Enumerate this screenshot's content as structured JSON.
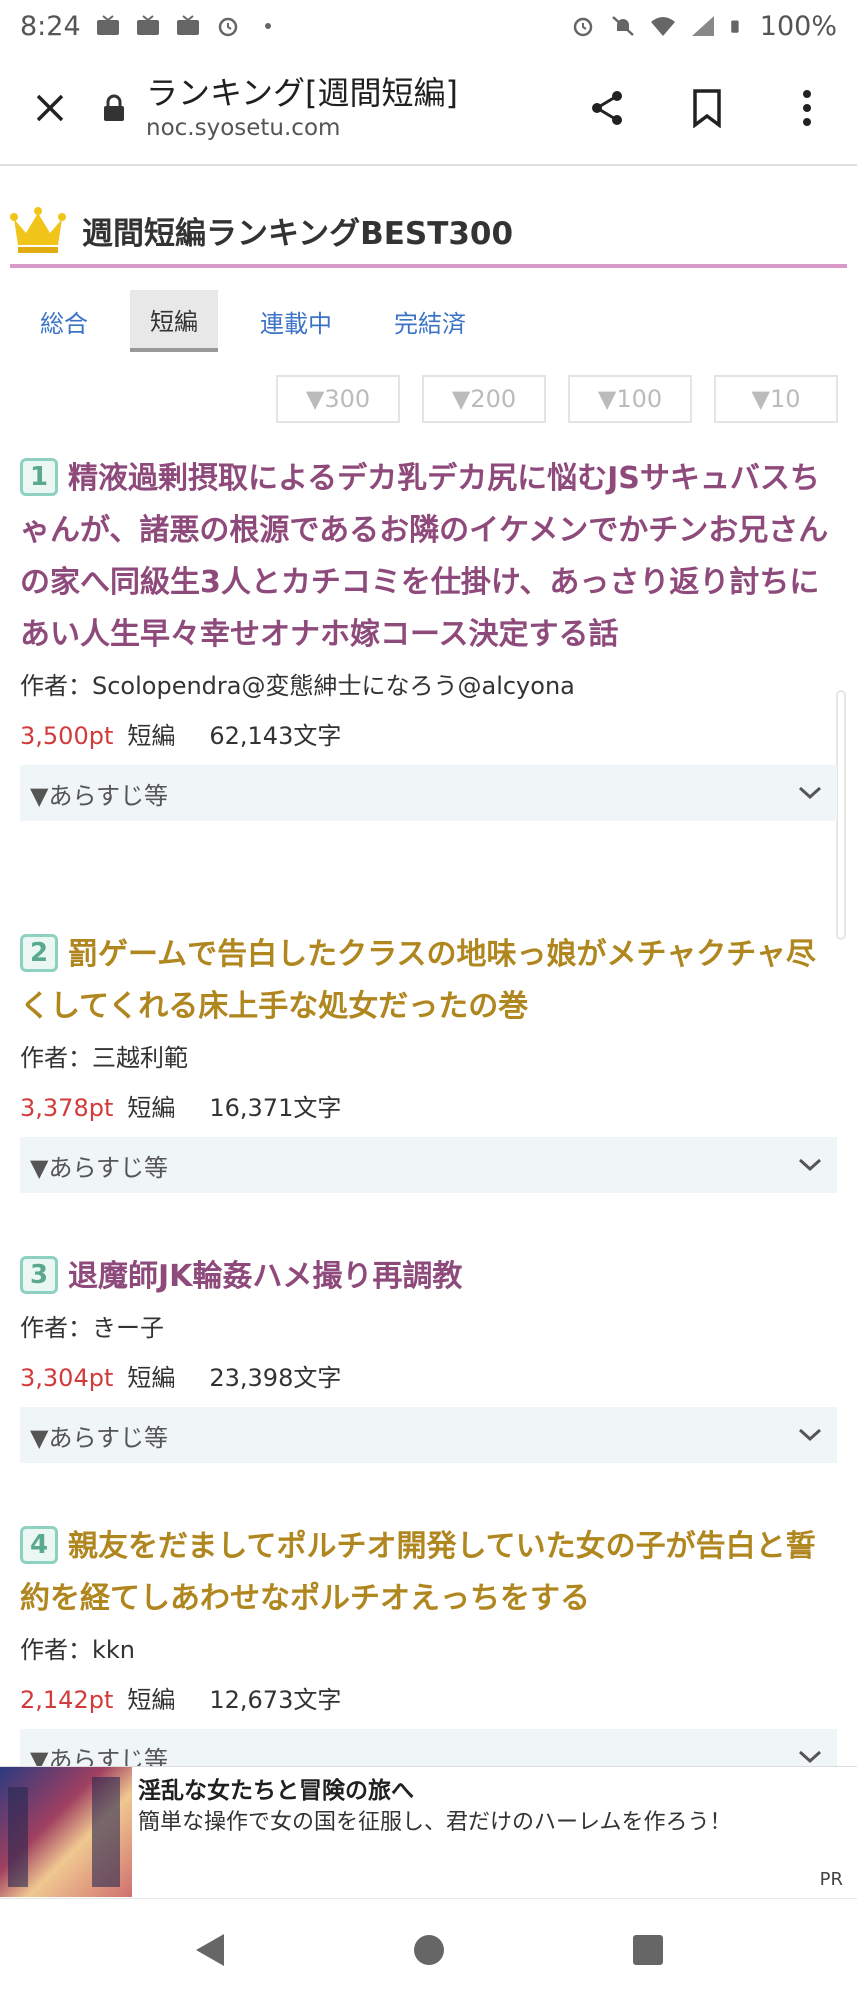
{
  "status_bar": {
    "time": "8:24",
    "battery": "100%"
  },
  "browser": {
    "title": "ランキング[週間短編]",
    "domain": "noc.syosetu.com"
  },
  "header": {
    "title": "週間短編ランキングBEST300"
  },
  "tabs": [
    {
      "label": "総合",
      "active": false
    },
    {
      "label": "短編",
      "active": true
    },
    {
      "label": "連載中",
      "active": false
    },
    {
      "label": "完結済",
      "active": false
    }
  ],
  "filters": [
    "▼300",
    "▼200",
    "▼100",
    "▼10"
  ],
  "entries": [
    {
      "rank": "1",
      "title": "精液過剰摂取によるデカ乳デカ尻に悩むJSサキュバスちゃんが、諸悪の根源であるお隣のイケメンでかチンお兄さんの家へ同級生3人とカチコミを仕掛け、あっさり返り討ちにあい人生早々幸せオナホ嫁コース決定する話",
      "author": "作者：Scolopendra@変態紳士になろう@alcyona",
      "points": "3,500pt",
      "genre": "短編",
      "length": "62,143文字",
      "summary": "▼あらすじ等"
    },
    {
      "rank": "2",
      "title": "罰ゲームで告白したクラスの地味っ娘がメチャクチャ尽くしてくれる床上手な処女だったの巻",
      "author": "作者：三越利範",
      "points": "3,378pt",
      "genre": "短編",
      "length": "16,371文字",
      "summary": "▼あらすじ等"
    },
    {
      "rank": "3",
      "title": "退魔師JK輪姦ハメ撮り再調教",
      "author": "作者：きー子",
      "points": "3,304pt",
      "genre": "短編",
      "length": "23,398文字",
      "summary": "▼あらすじ等"
    },
    {
      "rank": "4",
      "title": "親友をだましてポルチオ開発していた女の子が告白と誓約を経てしあわせなポルチオえっちをする",
      "author": "作者：kkn",
      "points": "2,142pt",
      "genre": "短編",
      "length": "12,673文字",
      "summary": "▼あらすじ等"
    }
  ],
  "ad": {
    "title": "淫乱な女たちと冒険の旅へ",
    "description": "簡単な操作で女の国を征服し、君だけのハーレムを作ろう！",
    "pr": "PR"
  },
  "colors": {
    "title_purple": "#8f4a7c",
    "title_gold": "#b0861f",
    "points_red": "#d13b3b",
    "tab_link": "#3b73c7",
    "header_underline": "#d99ac9"
  }
}
